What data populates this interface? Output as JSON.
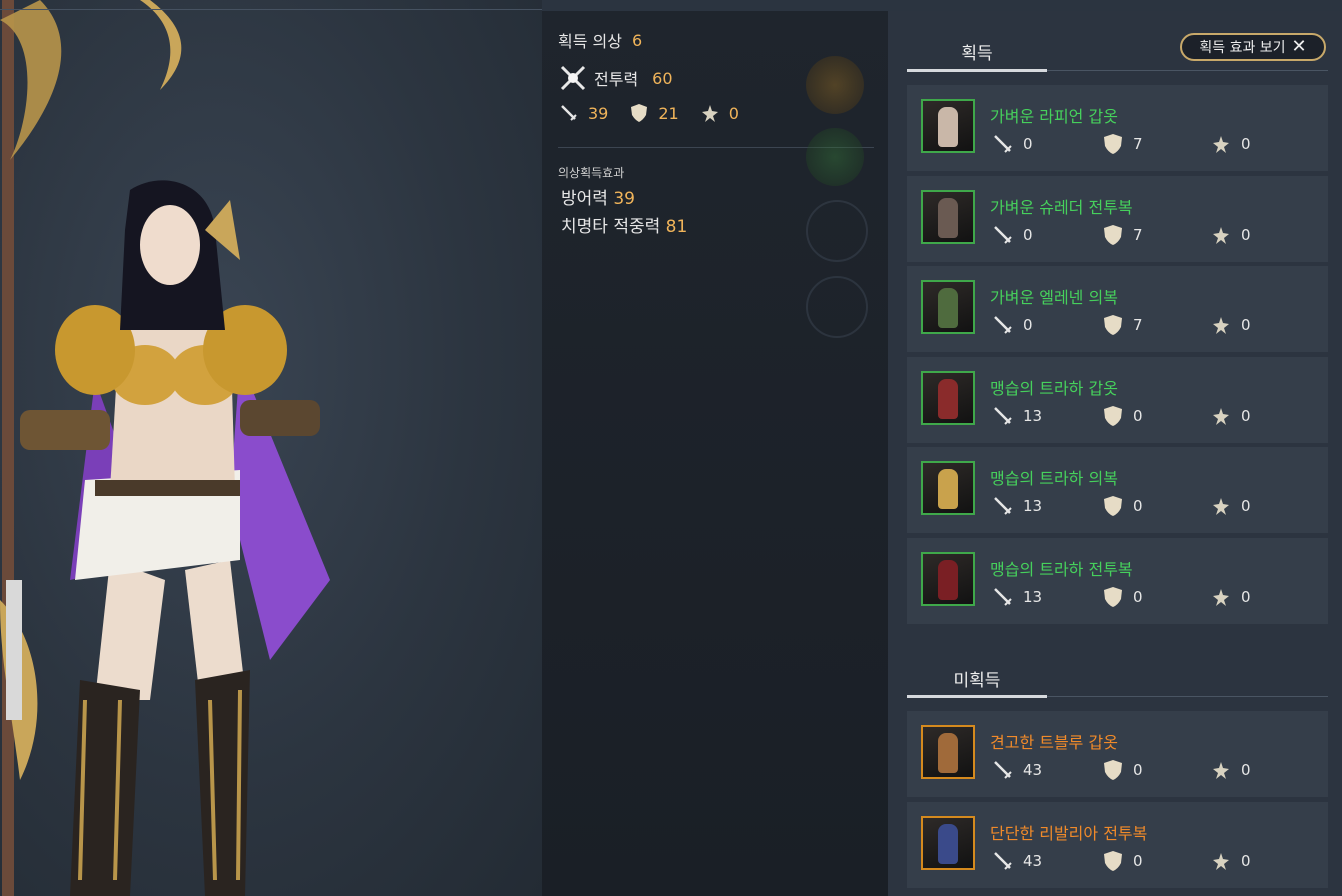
{
  "summary": {
    "acquired_label": "획득 의상",
    "acquired_count": "6",
    "combat_power_label": "전투력",
    "combat_power_value": "60",
    "attack": "39",
    "defense": "21",
    "special": "0"
  },
  "effects": {
    "title": "의상획득효과",
    "lines": [
      {
        "label": "방어력",
        "value": "39"
      },
      {
        "label": "치명타 적중력",
        "value": "81"
      }
    ]
  },
  "acquired_section": {
    "tab_label": "획득",
    "effect_button_label": "획득 효과 보기",
    "items": [
      {
        "name": "가벼운 라피언 갑옷",
        "attack": "0",
        "defense": "7",
        "special": "0",
        "tint": "#c9b7a8"
      },
      {
        "name": "가벼운 슈레더 전투복",
        "attack": "0",
        "defense": "7",
        "special": "0",
        "tint": "#6a5a52"
      },
      {
        "name": "가벼운 엘레넨 의복",
        "attack": "0",
        "defense": "7",
        "special": "0",
        "tint": "#4f6b3e"
      },
      {
        "name": "맹습의 트라하 갑옷",
        "attack": "13",
        "defense": "0",
        "special": "0",
        "tint": "#8a2b2b"
      },
      {
        "name": "맹습의 트라하 의복",
        "attack": "13",
        "defense": "0",
        "special": "0",
        "tint": "#c9a24c"
      },
      {
        "name": "맹습의 트라하 전투복",
        "attack": "13",
        "defense": "0",
        "special": "0",
        "tint": "#7a1f24"
      }
    ]
  },
  "unacquired_section": {
    "tab_label": "미획득",
    "items": [
      {
        "name": "견고한 트블루 갑옷",
        "attack": "43",
        "defense": "0",
        "special": "0",
        "tint": "#a06a3a"
      },
      {
        "name": "단단한 리발리아 전투복",
        "attack": "43",
        "defense": "0",
        "special": "0",
        "tint": "#3a4a8a"
      }
    ]
  }
}
